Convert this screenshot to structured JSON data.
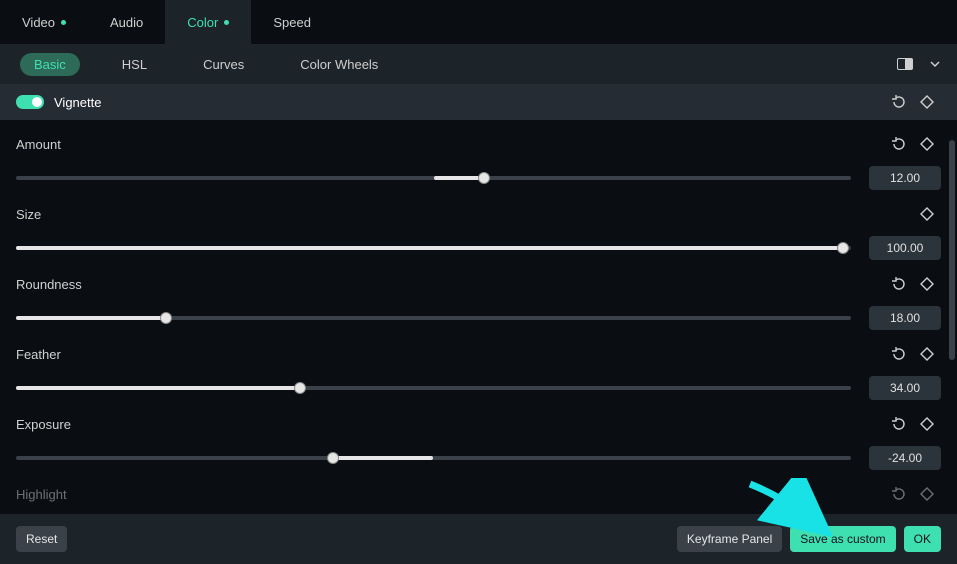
{
  "accent": "#3fe0b0",
  "topTabs": {
    "video": "Video",
    "audio": "Audio",
    "color": "Color",
    "speed": "Speed",
    "active": "Color"
  },
  "subTabs": {
    "basic": "Basic",
    "hsl": "HSL",
    "curves": "Curves",
    "colorWheels": "Color Wheels",
    "active": "Basic"
  },
  "section": {
    "title": "Vignette",
    "enabled": true
  },
  "params": {
    "amount": {
      "label": "Amount",
      "value": "12.00",
      "fillPct": 6,
      "knobPct": 56,
      "centerFill": true,
      "hasReset": true
    },
    "size": {
      "label": "Size",
      "value": "100.00",
      "fillPct": 99,
      "knobPct": 99,
      "centerFill": false,
      "hasReset": false
    },
    "roundness": {
      "label": "Roundness",
      "value": "18.00",
      "fillPct": 18,
      "knobPct": 18,
      "centerFill": false,
      "hasReset": true
    },
    "feather": {
      "label": "Feather",
      "value": "34.00",
      "fillPct": 34,
      "knobPct": 34,
      "centerFill": false,
      "hasReset": true
    },
    "exposure": {
      "label": "Exposure",
      "value": "-24.00",
      "fillPct": 12,
      "knobPct": 38,
      "centerFill": true,
      "centerNeg": true,
      "hasReset": true
    },
    "highlight": {
      "label": "Highlight"
    }
  },
  "buttons": {
    "reset": "Reset",
    "keyframePanel": "Keyframe Panel",
    "saveCustom": "Save as custom",
    "ok": "OK"
  },
  "icons": {
    "reset": "reset-icon",
    "keyframe": "keyframe-diamond-icon",
    "compare": "compare-split-icon",
    "chevron": "chevron-down-icon"
  }
}
